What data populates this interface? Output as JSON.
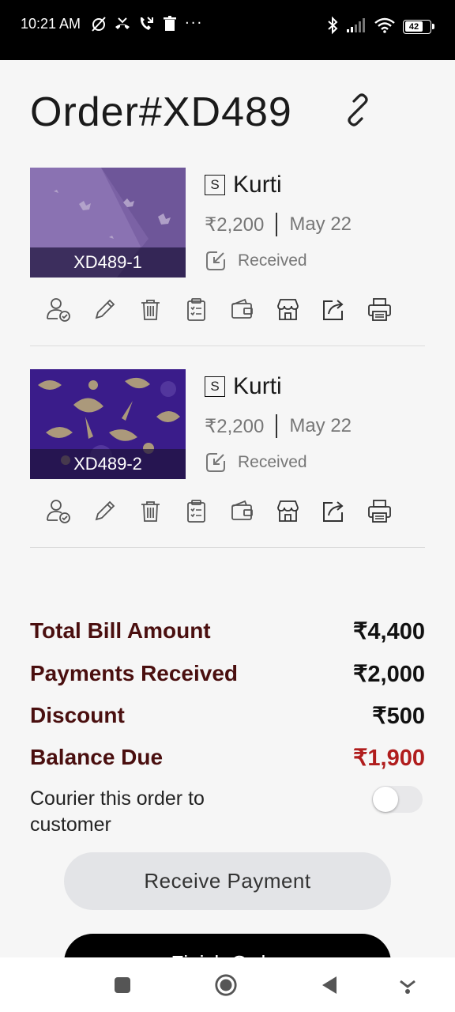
{
  "status_bar": {
    "time": "10:21 AM",
    "overflow": "···",
    "battery": "42"
  },
  "order": {
    "title": "Order#XD489"
  },
  "items": [
    {
      "code": "XD489-1",
      "size": "S",
      "name": "Kurti",
      "price": "₹2,200",
      "date": "May 22",
      "status": "Received"
    },
    {
      "code": "XD489-2",
      "size": "S",
      "name": "Kurti",
      "price": "₹2,200",
      "date": "May 22",
      "status": "Received"
    }
  ],
  "action_icons": [
    "user-check-icon",
    "pencil-icon",
    "trash-icon",
    "clipboard-icon",
    "wallet-icon",
    "store-icon",
    "share-icon",
    "printer-icon"
  ],
  "summary": {
    "total_label": "Total Bill Amount",
    "total_value": "₹4,400",
    "payments_label": "Payments Received",
    "payments_value": "₹2,000",
    "discount_label": "Discount",
    "discount_value": "₹500",
    "balance_label": "Balance Due",
    "balance_value": "₹1,900"
  },
  "courier": {
    "label": "Courier this order to customer",
    "enabled": false
  },
  "buttons": {
    "receive_payment": "Receive Payment",
    "finish_order": "Finish Order"
  },
  "colors": {
    "summary_label": "#4a0f0f",
    "balance_due": "#b01d1d",
    "fabric_1": "#7a5fa3",
    "fabric_2": "#3b1a8a"
  }
}
